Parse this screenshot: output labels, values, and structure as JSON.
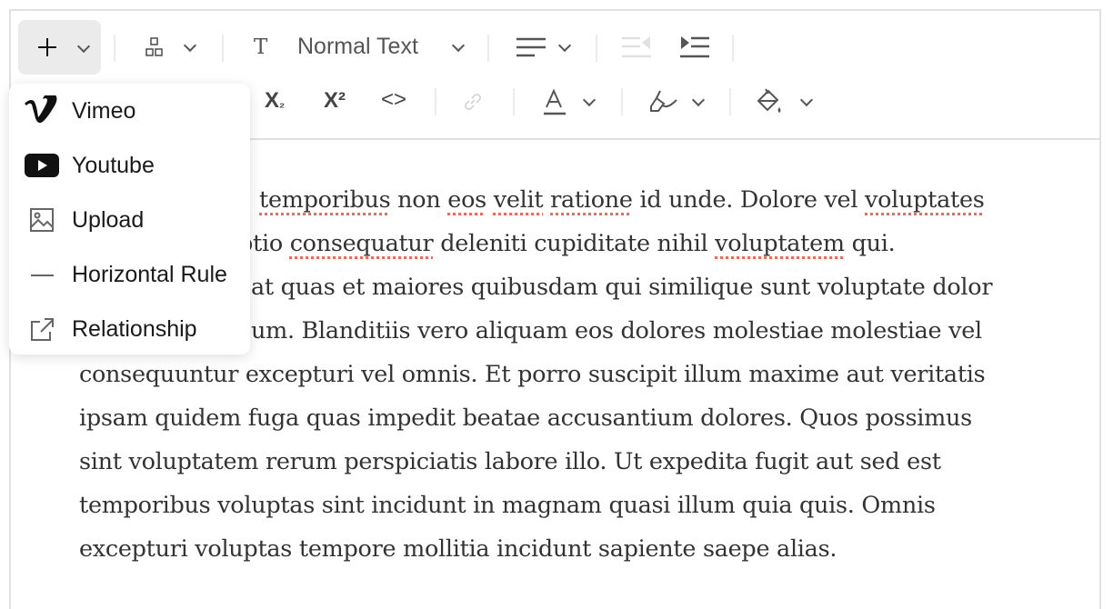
{
  "toolbar": {
    "insert_icon": "plus-icon",
    "block_icon": "layout-blocks-icon",
    "text_style": "Normal Text",
    "text_style_icon": "text-t-icon",
    "align_icon": "align-left-icon",
    "outdent_icon": "outdent-icon",
    "indent_icon": "indent-icon",
    "subscript": "X₂",
    "superscript": "X²",
    "code": "<>",
    "link_icon": "link-icon",
    "text_color_icon": "font-color-icon",
    "highlight_icon": "highlighter-icon",
    "background_icon": "paint-bucket-icon"
  },
  "insert_menu": {
    "items": [
      {
        "label": "Vimeo",
        "icon": "vimeo-icon"
      },
      {
        "label": "Youtube",
        "icon": "youtube-icon"
      },
      {
        "label": "Upload",
        "icon": "image-icon"
      },
      {
        "label": "Horizontal Rule",
        "icon": "horizontal-rule-icon"
      },
      {
        "label": "Relationship",
        "icon": "external-link-icon"
      }
    ]
  },
  "content": {
    "lines": [
      [
        [
          "temporibus",
          true
        ],
        [
          " non ",
          false
        ],
        [
          "eos",
          true
        ],
        [
          " ",
          false
        ],
        [
          "velit",
          true
        ],
        [
          " ",
          false
        ],
        [
          "ratione",
          true
        ],
        [
          " id unde. Dolore vel ",
          false
        ],
        [
          "voluptates",
          true
        ]
      ],
      [
        [
          "ptio ",
          false
        ],
        [
          "consequatur",
          true
        ],
        [
          " deleniti cupiditate nihil ",
          false
        ],
        [
          "voluptatem",
          true
        ],
        [
          " qui.",
          false
        ]
      ],
      [
        [
          "at quas et maiores quibusdam qui similique sunt voluptate dolor",
          false
        ]
      ],
      [
        [
          "um. Blanditiis vero aliquam eos dolores molestiae molestiae vel",
          false
        ]
      ],
      [
        [
          "consequuntur excepturi vel omnis. Et porro suscipit illum maxime aut veritatis",
          false
        ]
      ],
      [
        [
          "ipsam quidem fuga quas impedit beatae accusantium dolores. Quos possimus",
          false
        ]
      ],
      [
        [
          "sint voluptatem rerum perspiciatis labore illo. Ut expedita fugit aut sed est",
          false
        ]
      ],
      [
        [
          "temporibus voluptas sint incidunt in magnam quasi illum quia quis. Omnis",
          false
        ]
      ],
      [
        [
          "excepturi voluptas tempore mollitia incidunt sapiente saepe alias.",
          false
        ]
      ]
    ]
  },
  "colors": {
    "spellcheck": "#f0685e",
    "text": "#333333",
    "active_button": "#ebebeb"
  }
}
